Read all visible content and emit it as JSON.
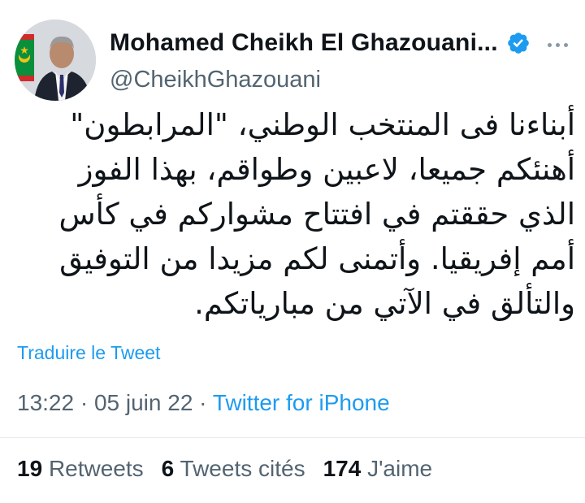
{
  "author": {
    "display_name": "Mohamed Cheikh El Ghazouani...",
    "handle": "@CheikhGhazouani",
    "verified": true,
    "avatar": "profile-photo-with-flag"
  },
  "tweet": {
    "lines": [
      "أبناءنا  فى المنتخب الوطني، \"المرابطون\"",
      "أهنئكم جميعا، لاعبين وطواقم،  بهذا الفوز",
      "الذي حققتم في افتتاح مشواركم في كأس",
      "أمم إفريقيا. وأتمنى لكم مزيدا من التوفيق",
      "والتألق في الآتي من مبارياتكم."
    ],
    "translate_label": "Traduire le Tweet"
  },
  "meta": {
    "time": "13:22",
    "separator": " · ",
    "date": "05 juin 22",
    "source": "Twitter for iPhone"
  },
  "stats": {
    "retweets_count": "19",
    "retweets_label": "Retweets",
    "quotes_count": "6",
    "quotes_label": "Tweets cités",
    "likes_count": "174",
    "likes_label": "J'aime"
  },
  "colors": {
    "link": "#1d9bf0",
    "secondary_text": "#536471",
    "primary_text": "#0f1419",
    "verified_badge": "#1d9bf0"
  },
  "icons": {
    "verified": "verified-badge-icon",
    "more": "more-options-icon"
  }
}
